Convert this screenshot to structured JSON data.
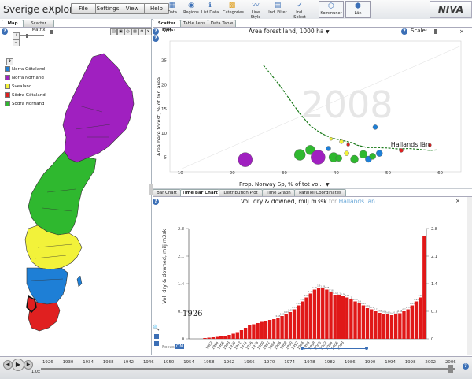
{
  "app": {
    "title": "Sverige eXplorer"
  },
  "menu": [
    "File",
    "Settings",
    "View",
    "Help"
  ],
  "toolbar": [
    {
      "label": "Data",
      "icon": "data-icon"
    },
    {
      "label": "Regions",
      "icon": "regions-icon"
    },
    {
      "label": "List Data",
      "icon": "list-data-icon"
    },
    {
      "label": "Categories",
      "icon": "categories-icon"
    },
    {
      "label": "Line Style",
      "icon": "line-style-icon"
    },
    {
      "label": "Ind. Filter",
      "icon": "filter-icon"
    },
    {
      "label": "Ind. Select",
      "icon": "select-icon"
    },
    {
      "label": "Kommuner",
      "icon": "kommuner-icon"
    },
    {
      "label": "Län",
      "icon": "lan-icon"
    }
  ],
  "logo": "NIVA",
  "left": {
    "tabs": [
      "Map",
      "Scatter Matrix"
    ],
    "legend": [
      {
        "label": "Norra Götaland",
        "color": "#1e7fd6"
      },
      {
        "label": "Norra Norrland",
        "color": "#a020c0"
      },
      {
        "label": "Svealand",
        "color": "#f2f23a"
      },
      {
        "label": "Södra Götaland",
        "color": "#e02020"
      },
      {
        "label": "Södra Norrland",
        "color": "#2fb82f"
      }
    ]
  },
  "scatter": {
    "tabs": [
      "Scatter Plot",
      "Table Lens",
      "Data Table"
    ],
    "size_label": "Size:",
    "title": "Area forest land, 1000 ha",
    "scale_label": "Scale:",
    "year": "2008",
    "ylabel": "Area bare forest, % of for. area",
    "xlabel": "Prop. Norway Sp, % of tot vol.",
    "annotation": "Hallands län",
    "chart_data": {
      "type": "scatter",
      "x_ticks": [
        10,
        20,
        30,
        40,
        50,
        60
      ],
      "y_ticks": [
        5,
        10,
        15,
        20,
        25
      ],
      "xlim": [
        8,
        64
      ],
      "ylim": [
        2,
        29
      ],
      "points": [
        {
          "x": 22.5,
          "y": 4.5,
          "color": "#a020c0",
          "size": 9
        },
        {
          "x": 33,
          "y": 5.5,
          "color": "#2fb82f",
          "size": 7
        },
        {
          "x": 35,
          "y": 6.5,
          "color": "#2fb82f",
          "size": 6
        },
        {
          "x": 36.5,
          "y": 5,
          "color": "#a020c0",
          "size": 9
        },
        {
          "x": 38.5,
          "y": 6.8,
          "color": "#1e7fd6",
          "size": 3
        },
        {
          "x": 39.5,
          "y": 5,
          "color": "#2fb82f",
          "size": 6
        },
        {
          "x": 40.5,
          "y": 4.8,
          "color": "#2fb82f",
          "size": 4
        },
        {
          "x": 42,
          "y": 5.8,
          "color": "#f2f23a",
          "size": 3
        },
        {
          "x": 43.5,
          "y": 4.6,
          "color": "#2fb82f",
          "size": 5
        },
        {
          "x": 45.2,
          "y": 5.6,
          "color": "#2fb82f",
          "size": 5
        },
        {
          "x": 46.2,
          "y": 4.6,
          "color": "#1e7fd6",
          "size": 4
        },
        {
          "x": 47,
          "y": 5.2,
          "color": "#2fb82f",
          "size": 4
        },
        {
          "x": 48.3,
          "y": 5.8,
          "color": "#1e7fd6",
          "size": 4
        },
        {
          "x": 47.5,
          "y": 11.2,
          "color": "#1e7fd6",
          "size": 3
        },
        {
          "x": 52.5,
          "y": 6.4,
          "color": "#e02020",
          "size": 2.5
        },
        {
          "x": 41,
          "y": 8.2,
          "color": "#f2f23a",
          "size": 2.5
        },
        {
          "x": 39,
          "y": 8.8,
          "color": "#f2f23a",
          "size": 2
        },
        {
          "x": 42.3,
          "y": 7.6,
          "color": "#e02020",
          "size": 2
        },
        {
          "x": 58,
          "y": 7.5,
          "color": "#e02020",
          "size": 2
        }
      ],
      "trail": [
        [
          26,
          24
        ],
        [
          29,
          20
        ],
        [
          31,
          17
        ],
        [
          33,
          14
        ],
        [
          35,
          11.5
        ],
        [
          37,
          10
        ],
        [
          39,
          9
        ],
        [
          41,
          8.5
        ],
        [
          43,
          8
        ],
        [
          44,
          7.5
        ],
        [
          46,
          7
        ],
        [
          48,
          7
        ],
        [
          50,
          6.9
        ],
        [
          52,
          6.7
        ],
        [
          54,
          6.8
        ],
        [
          56,
          6.6
        ],
        [
          58,
          6.4
        ],
        [
          59.5,
          6.5
        ]
      ]
    }
  },
  "time": {
    "tabs": [
      "Bar Chart",
      "Time Bar Chart",
      "Distribution Plot",
      "Time Graph",
      "Parallel Coordinates"
    ],
    "title": "Vol. dry & downed, milj m3sk",
    "for_label": "for",
    "region": "Hallands län",
    "ylabel": "Vol. dry & downed, milj m3sk",
    "start_year": "1926",
    "focus_label": "Focus",
    "focus_on": "ON",
    "chart_data": {
      "type": "bar",
      "y_ticks": [
        0,
        0.7,
        1.4,
        2.1,
        2.8
      ],
      "ylim": [
        0,
        2.8
      ],
      "x_labels": [
        "1962",
        "1964",
        "1966",
        "1968",
        "1970",
        "1972",
        "1974",
        "1976",
        "1978",
        "1980",
        "1982",
        "1984",
        "1986",
        "1988",
        "1990",
        "1992",
        "1994",
        "1996",
        "1998",
        "2000",
        "2002",
        "2004",
        "2006",
        "2008"
      ],
      "values": [
        0.02,
        0.03,
        0.04,
        0.05,
        0.06,
        0.08,
        0.1,
        0.13,
        0.17,
        0.22,
        0.28,
        0.34,
        0.37,
        0.4,
        0.43,
        0.45,
        0.48,
        0.5,
        0.53,
        0.58,
        0.63,
        0.68,
        0.75,
        0.85,
        0.95,
        1.05,
        1.15,
        1.25,
        1.3,
        1.28,
        1.25,
        1.18,
        1.12,
        1.1,
        1.08,
        1.05,
        1.0,
        0.95,
        0.9,
        0.85,
        0.78,
        0.75,
        0.7,
        0.66,
        0.64,
        0.62,
        0.6,
        0.62,
        0.65,
        0.7,
        0.75,
        0.85,
        0.95,
        1.05,
        2.6
      ],
      "color": "#e01818"
    }
  },
  "timeline": {
    "years": [
      "1926",
      "1930",
      "1934",
      "1938",
      "1942",
      "1946",
      "1950",
      "1954",
      "1958",
      "1962",
      "1966",
      "1970",
      "1974",
      "1978",
      "1982",
      "1986",
      "1990",
      "1994",
      "1998",
      "2002",
      "2006"
    ],
    "speed": "1.0x"
  }
}
